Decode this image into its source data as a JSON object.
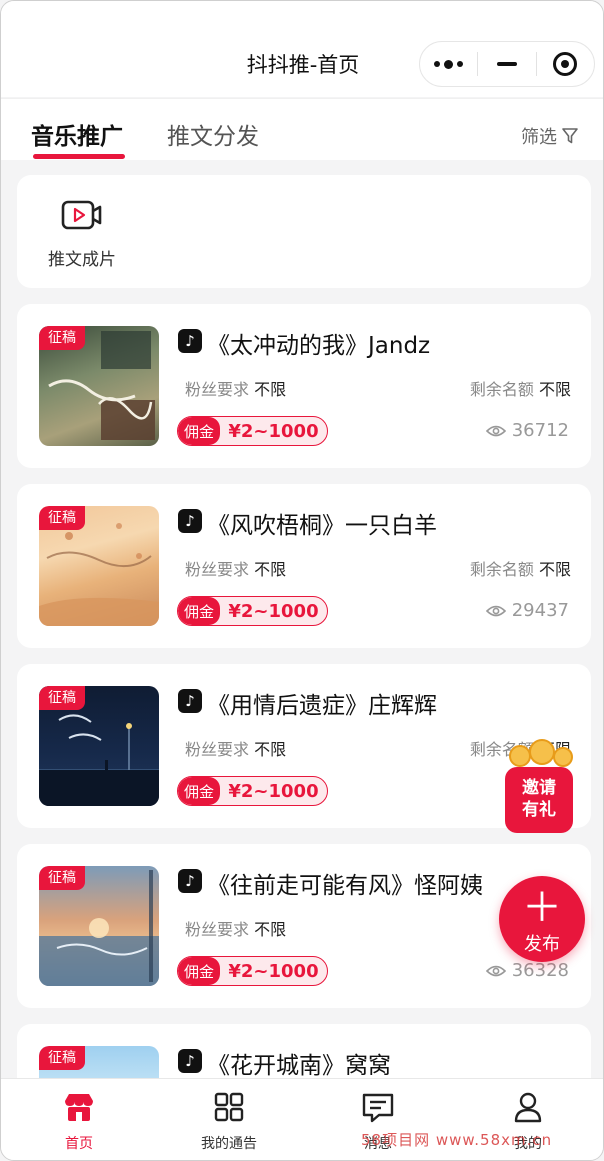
{
  "nav": {
    "title": "抖抖推-首页"
  },
  "tabs": {
    "active": "音乐推广",
    "inactive": "推文分发",
    "filter": "筛选"
  },
  "quick": {
    "label": "推文成片"
  },
  "cards": [
    {
      "tag": "征稿",
      "title": "《太冲动的我》Jandz",
      "req_label": "粉丝要求",
      "req_value": "不限",
      "remain_label": "剩余名额",
      "remain_value": "不限",
      "commission_label": "佣金",
      "commission_amount": "¥2~1000",
      "views": "36712"
    },
    {
      "tag": "征稿",
      "title": "《风吹梧桐》一只白羊",
      "req_label": "粉丝要求",
      "req_value": "不限",
      "remain_label": "剩余名额",
      "remain_value": "不限",
      "commission_label": "佣金",
      "commission_amount": "¥2~1000",
      "views": "29437"
    },
    {
      "tag": "征稿",
      "title": "《用情后遗症》庄辉辉",
      "req_label": "粉丝要求",
      "req_value": "不限",
      "remain_label": "剩余名额",
      "remain_value": "不限",
      "commission_label": "佣金",
      "commission_amount": "¥2~1000",
      "views": ""
    },
    {
      "tag": "征稿",
      "title": "《往前走可能有风》怪阿姨",
      "req_label": "粉丝要求",
      "req_value": "不限",
      "remain_label": "剩余",
      "remain_value": "",
      "commission_label": "佣金",
      "commission_amount": "¥2~1000",
      "views": "36328"
    },
    {
      "tag": "征稿",
      "title": "《花开城南》窝窝"
    }
  ],
  "invite": {
    "line1": "邀请",
    "line2": "有礼"
  },
  "publish": {
    "label": "发布"
  },
  "tabbar": [
    {
      "label": "首页"
    },
    {
      "label": "我的通告"
    },
    {
      "label": "消息"
    },
    {
      "label": "我的"
    }
  ],
  "watermark": "58项目网 www.58xm.cn",
  "colors": {
    "accent": "#e8163c"
  }
}
